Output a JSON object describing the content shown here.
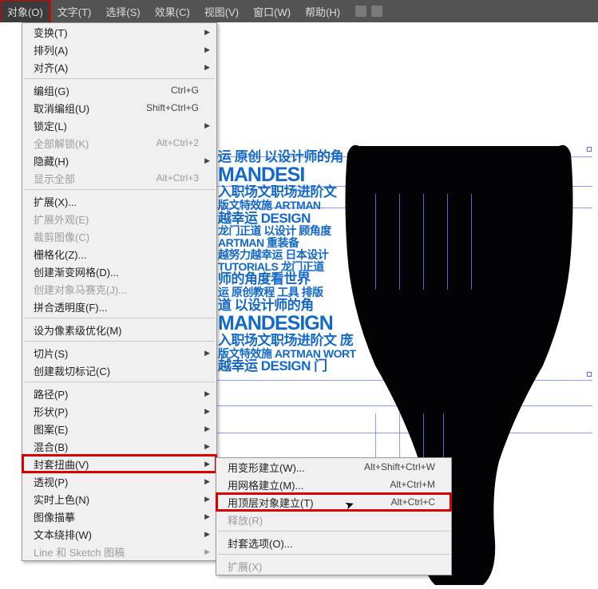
{
  "menubar": {
    "items": [
      {
        "label": "对象(O)"
      },
      {
        "label": "文字(T)"
      },
      {
        "label": "选择(S)"
      },
      {
        "label": "效果(C)"
      },
      {
        "label": "视图(V)"
      },
      {
        "label": "窗口(W)"
      },
      {
        "label": "帮助(H)"
      }
    ]
  },
  "dropdown": [
    {
      "type": "item",
      "label": "变换(T)",
      "sub": true
    },
    {
      "type": "item",
      "label": "排列(A)",
      "sub": true
    },
    {
      "type": "item",
      "label": "对齐(A)",
      "sub": true
    },
    {
      "type": "divider"
    },
    {
      "type": "item",
      "label": "编组(G)",
      "shortcut": "Ctrl+G"
    },
    {
      "type": "item",
      "label": "取消编组(U)",
      "shortcut": "Shift+Ctrl+G"
    },
    {
      "type": "item",
      "label": "锁定(L)",
      "sub": true
    },
    {
      "type": "item",
      "label": "全部解锁(K)",
      "shortcut": "Alt+Ctrl+2",
      "disabled": true
    },
    {
      "type": "item",
      "label": "隐藏(H)",
      "sub": true
    },
    {
      "type": "item",
      "label": "显示全部",
      "shortcut": "Alt+Ctrl+3",
      "disabled": true
    },
    {
      "type": "divider"
    },
    {
      "type": "item",
      "label": "扩展(X)..."
    },
    {
      "type": "item",
      "label": "扩展外观(E)",
      "disabled": true
    },
    {
      "type": "item",
      "label": "裁剪图像(C)",
      "disabled": true
    },
    {
      "type": "item",
      "label": "栅格化(Z)..."
    },
    {
      "type": "item",
      "label": "创建渐变网格(D)..."
    },
    {
      "type": "item",
      "label": "创建对象马赛克(J)...",
      "disabled": true
    },
    {
      "type": "item",
      "label": "拼合透明度(F)..."
    },
    {
      "type": "divider"
    },
    {
      "type": "item",
      "label": "设为像素级优化(M)"
    },
    {
      "type": "divider"
    },
    {
      "type": "item",
      "label": "切片(S)",
      "sub": true
    },
    {
      "type": "item",
      "label": "创建裁切标记(C)"
    },
    {
      "type": "divider"
    },
    {
      "type": "item",
      "label": "路径(P)",
      "sub": true
    },
    {
      "type": "item",
      "label": "形状(P)",
      "sub": true
    },
    {
      "type": "item",
      "label": "图案(E)",
      "sub": true
    },
    {
      "type": "item",
      "label": "混合(B)",
      "sub": true
    },
    {
      "type": "item",
      "label": "封套扭曲(V)",
      "sub": true,
      "highlight": true
    },
    {
      "type": "item",
      "label": "透视(P)",
      "sub": true
    },
    {
      "type": "item",
      "label": "实时上色(N)",
      "sub": true
    },
    {
      "type": "item",
      "label": "图像描摹",
      "sub": true
    },
    {
      "type": "item",
      "label": "文本绕排(W)",
      "sub": true
    },
    {
      "type": "item",
      "label": "Line 和 Sketch 图稿",
      "sub": true,
      "disabled": true
    }
  ],
  "submenu": [
    {
      "type": "item",
      "label": "用变形建立(W)...",
      "shortcut": "Alt+Shift+Ctrl+W"
    },
    {
      "type": "item",
      "label": "用网格建立(M)...",
      "shortcut": "Alt+Ctrl+M"
    },
    {
      "type": "item",
      "label": "用顶层对象建立(T)",
      "shortcut": "Alt+Ctrl+C",
      "highlight": true
    },
    {
      "type": "item",
      "label": "释放(R)",
      "disabled": true
    },
    {
      "type": "divider"
    },
    {
      "type": "item",
      "label": "封套选项(O)..."
    },
    {
      "type": "divider"
    },
    {
      "type": "item",
      "label": "扩展(X)",
      "disabled": true
    }
  ],
  "poster": {
    "l1": "运 原创 以设计师的角",
    "l2": "MANDESI",
    "l3": "入职场文职场进阶文",
    "l4": "版文特效施 ARTMAN",
    "l5": "越幸运 DESIGN",
    "l6": "龙门正道 以设计 顾角度",
    "l7": "ARTMAN 重装备",
    "l8": "越努力越幸运 日本设计",
    "l9": "TUTORIALS 龙门正道",
    "l10": "师的角度看世界",
    "l11": "运 原创教程 工具 排版",
    "l12": "道 以设计师的角",
    "l13": "MANDESIGN",
    "l14": "入职场文职场进阶文 庞",
    "l15": "版文特效施 ARTMAN WORT",
    "l16": "越幸运 DESIGN 门"
  }
}
